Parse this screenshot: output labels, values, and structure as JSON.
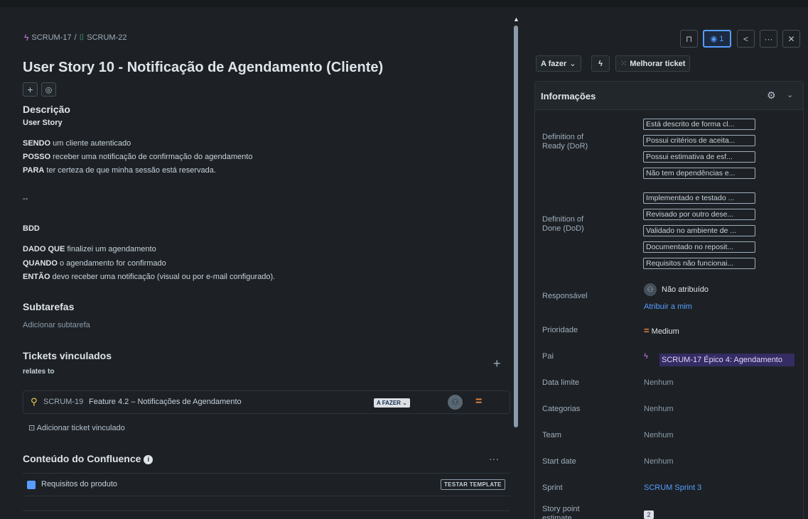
{
  "breadcrumb": {
    "epic_key": "SCRUM-17",
    "separator": "/",
    "story_key": "SCRUM-22"
  },
  "issue": {
    "title": "User Story 10 - Notificação de Agendamento (Cliente)"
  },
  "description": {
    "heading": "Descrição",
    "story_heading": "User Story",
    "sendo_kw": "SENDO",
    "sendo_text": " um cliente autenticado",
    "posso_kw": "POSSO",
    "posso_text": " receber uma notificação de confirmação do agendamento",
    "para_kw": "PARA",
    "para_text": " ter certeza de que minha sessão está reservada.",
    "separator": "--",
    "bdd_heading": "BDD",
    "dado_kw": "DADO QUE",
    "dado_text": " finalizei um agendamento",
    "quando_kw": "QUANDO",
    "quando_text": " o agendamento for confirmado",
    "entao_kw": "ENTÃO",
    "entao_text": " devo receber uma notificação (visual ou por e-mail configurado)."
  },
  "subtasks": {
    "heading": "Subtarefas",
    "add_label": "Adicionar subtarefa"
  },
  "linked": {
    "heading": "Tickets vinculados",
    "relation": "relates to",
    "ticket_key": "SCRUM-19",
    "ticket_name": "Feature 4.2 – Notificações de Agendamento",
    "ticket_status": "A FAZER",
    "add_label": "Adicionar ticket vinculado"
  },
  "confluence": {
    "heading": "Conteúdo do Confluence",
    "page_label": "Requisitos do produto",
    "template_btn": "TESTAR TEMPLATE"
  },
  "toolbar": {
    "watch_count": "1"
  },
  "actions": {
    "status": "A fazer",
    "improve": "Melhorar ticket"
  },
  "info": {
    "title": "Informações",
    "dor_label": "Definition of Ready (DoR)",
    "dor_tags": [
      "Está descrito de forma cl...",
      "Possui critérios de aceita...",
      "Possui estimativa de esf...",
      "Não tem dependências e..."
    ],
    "dod_label": "Definition of Done (DoD)",
    "dod_tags": [
      "Implementado e testado ...",
      "Revisado por outro dese...",
      "Validado no ambiente de ...",
      "Documentado no reposit...",
      "Requisitos não funcionai..."
    ],
    "assignee_label": "Responsável",
    "assignee_value": "Não atribuído",
    "assign_me": "Atribuir a mim",
    "priority_label": "Prioridade",
    "priority_value": "Medium",
    "parent_label": "Pai",
    "parent_value": "SCRUM-17 Épico 4: Agendamento",
    "due_label": "Data limite",
    "due_value": "Nenhum",
    "categories_label": "Categorias",
    "categories_value": "Nenhum",
    "team_label": "Team",
    "team_value": "Nenhum",
    "start_label": "Start date",
    "start_value": "Nenhum",
    "sprint_label": "Sprint",
    "sprint_value": "SCRUM Sprint 3",
    "sp_label": "Story point estimate",
    "sp_value": "2"
  }
}
